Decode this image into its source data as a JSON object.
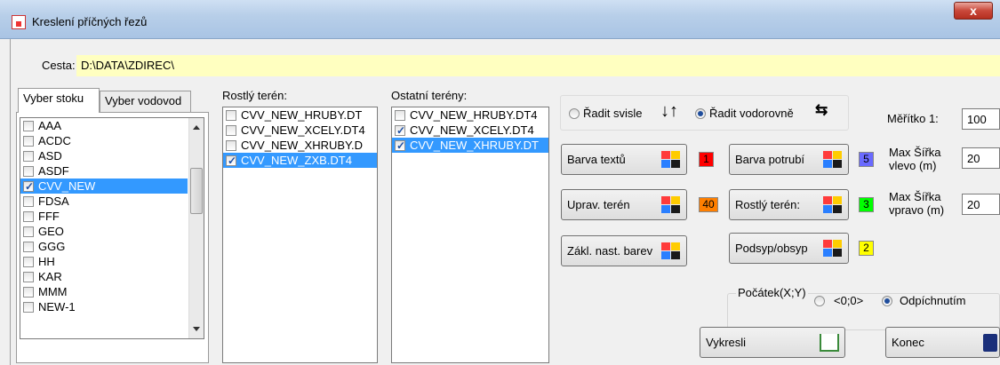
{
  "window": {
    "title": "Kreslení příčných řezů",
    "close_label": "x"
  },
  "path": {
    "label": "Cesta:",
    "value": "D:\\DATA\\ZDIREC\\"
  },
  "tabs": [
    {
      "label": "Vyber stoku",
      "active": true
    },
    {
      "label": "Vyber vodovod",
      "active": false
    }
  ],
  "stoky": [
    {
      "label": "AAA",
      "checked": false,
      "selected": false
    },
    {
      "label": "ACDC",
      "checked": false,
      "selected": false
    },
    {
      "label": "ASD",
      "checked": false,
      "selected": false
    },
    {
      "label": "ASDF",
      "checked": false,
      "selected": false
    },
    {
      "label": "CVV_NEW",
      "checked": true,
      "selected": true
    },
    {
      "label": "FDSA",
      "checked": false,
      "selected": false
    },
    {
      "label": "FFF",
      "checked": false,
      "selected": false
    },
    {
      "label": "GEO",
      "checked": false,
      "selected": false
    },
    {
      "label": "GGG",
      "checked": false,
      "selected": false
    },
    {
      "label": "HH",
      "checked": false,
      "selected": false
    },
    {
      "label": "KAR",
      "checked": false,
      "selected": false
    },
    {
      "label": "MMM",
      "checked": false,
      "selected": false
    },
    {
      "label": "NEW-1",
      "checked": false,
      "selected": false
    }
  ],
  "rostly_teren": {
    "label": "Rostlý terén:",
    "items": [
      {
        "label": "CVV_NEW_HRUBY.DT",
        "checked": false,
        "selected": false
      },
      {
        "label": "CVV_NEW_XCELY.DT4",
        "checked": false,
        "selected": false
      },
      {
        "label": "CVV_NEW_XHRUBY.D",
        "checked": false,
        "selected": false
      },
      {
        "label": "CVV_NEW_ZXB.DT4",
        "checked": true,
        "selected": true
      }
    ]
  },
  "ostatni_tereny": {
    "label": "Ostatní terény:",
    "items": [
      {
        "label": "CVV_NEW_HRUBY.DT4",
        "checked": false,
        "selected": false
      },
      {
        "label": "CVV_NEW_XCELY.DT4",
        "checked": true,
        "selected": false
      },
      {
        "label": "CVV_NEW_XHRUBY.DT",
        "checked": true,
        "selected": true
      }
    ]
  },
  "sorting": {
    "vertical_label": "Řadit svisle",
    "horizontal_label": "Řadit vodorovně",
    "selected": "horizontal"
  },
  "buttons": {
    "barva_textu": "Barva textů",
    "barva_potrubi": "Barva potrubí",
    "uprav_teren": "Uprav. terén",
    "rostly_teren": "Rostlý terén:",
    "zakl_nast": "Zákl. nast. barev",
    "podsyp": "Podsyp/obsyp",
    "vykresli": "Vykresli",
    "konec": "Konec"
  },
  "color_swatches": {
    "barva_textu": {
      "value": "1",
      "color": "#ff0000"
    },
    "barva_potrubi": {
      "value": "5",
      "color": "#6a6aff"
    },
    "uprav_teren": {
      "value": "40",
      "color": "#ff7f00"
    },
    "rostly_teren": {
      "value": "3",
      "color": "#00ff00"
    },
    "podsyp": {
      "value": "2",
      "color": "#ffff00"
    }
  },
  "scale": {
    "label": "Měřítko  1:",
    "value": "100"
  },
  "max_left": {
    "label1": "Max Šířka",
    "label2": "vlevo (m)",
    "value": "20"
  },
  "max_right": {
    "label1": "Max Šířka",
    "label2": "vpravo (m)",
    "value": "20"
  },
  "origin": {
    "label": "Počátek(X;Y)",
    "opt1": "<0;0>",
    "opt2": "Odpíchnutím",
    "selected": "opt2"
  }
}
